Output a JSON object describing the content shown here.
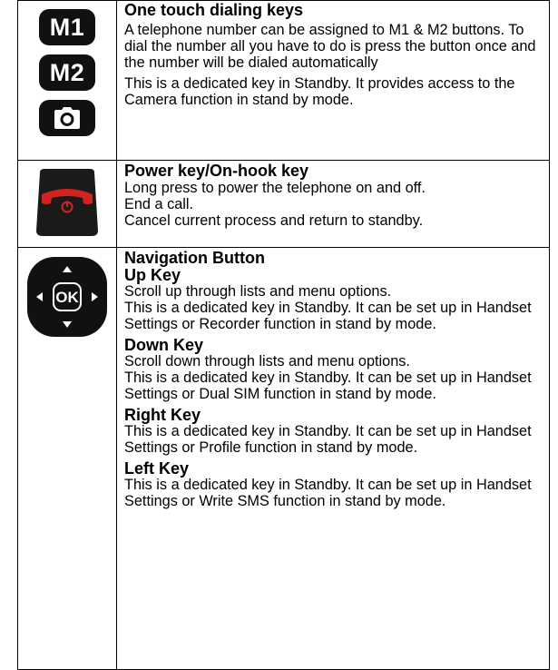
{
  "rows": [
    {
      "title": "One touch dialing keys",
      "keys": [
        "M1",
        "M2"
      ],
      "icon": "camera-icon",
      "paragraphs": [
        "A telephone number can be assigned to M1 & M2 buttons. To dial the number all you have to do is press the button once and the number will be dialed automatically",
        "This is a dedicated key in Standby. It provides access to the Camera function in stand by mode."
      ]
    },
    {
      "title": "Power key/On-hook key",
      "icon": "power-end-call-icon",
      "lines": [
        "Long press to power the telephone on and off.",
        "End a call.",
        "Cancel current process and return to standby."
      ]
    },
    {
      "title": "Navigation Button",
      "icon": "navigation-pad-icon",
      "ok_label": "OK",
      "sections": [
        {
          "heading": "Up Key",
          "lines": [
            "Scroll up through lists and menu options.",
            "This is a dedicated key in Standby. It can be set up in Handset Settings or Recorder function in stand by mode."
          ]
        },
        {
          "heading": "Down Key",
          "lines": [
            "Scroll down through lists and menu options.",
            "This is a dedicated key in Standby. It can be set up in Handset Settings or Dual SIM function in stand by mode."
          ]
        },
        {
          "heading": "Right Key",
          "lines": [
            "This is a dedicated key in Standby. It can be set up in Handset Settings or Profile function in stand by mode."
          ]
        },
        {
          "heading": "Left Key",
          "lines": [
            "This is a dedicated key in Standby. It can be set up in Handset Settings or Write SMS function in stand by mode."
          ]
        }
      ]
    }
  ],
  "colors": {
    "key_black": "#111111",
    "power_red": "#d2231f",
    "power_body": "#1a1a1a"
  }
}
